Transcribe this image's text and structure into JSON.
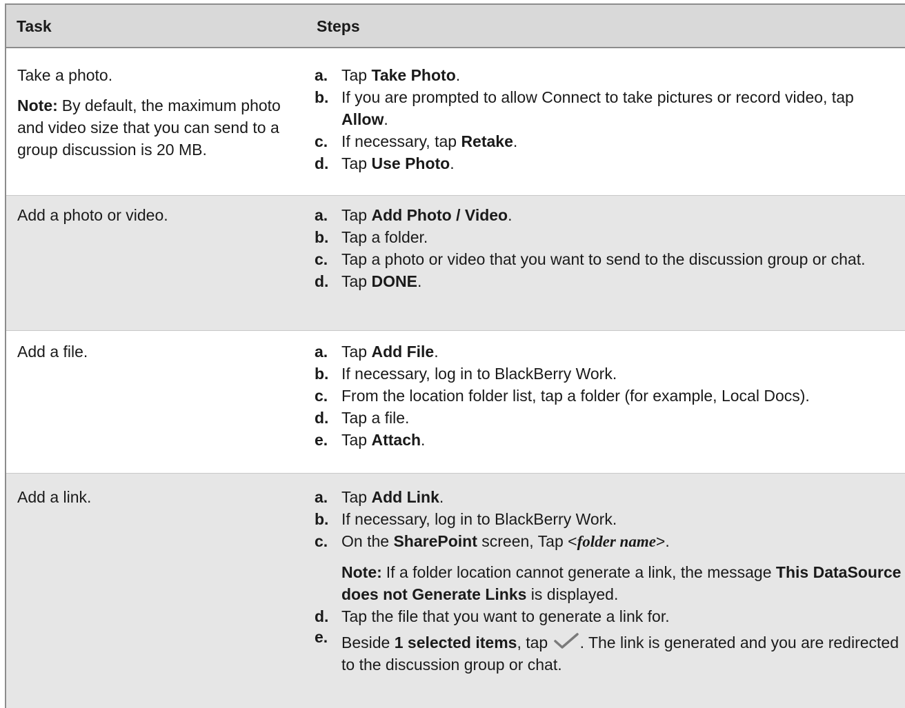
{
  "header": {
    "task": "Task",
    "steps": "Steps"
  },
  "rows": [
    {
      "task": "Take a photo.",
      "note_label": "Note:",
      "note_text": "By default, the maximum photo and video size that you can send to a group discussion is 20 MB.",
      "steps": [
        {
          "letter": "a.",
          "pre": "Tap ",
          "bold": "Take Photo",
          "post": "."
        },
        {
          "letter": "b.",
          "pre": "If you are prompted to allow Connect to take pictures or record video, tap ",
          "bold": "Allow",
          "post": "."
        },
        {
          "letter": "c.",
          "pre": "If necessary, tap ",
          "bold": "Retake",
          "post": "."
        },
        {
          "letter": "d.",
          "pre": "Tap ",
          "bold": "Use Photo",
          "post": "."
        }
      ]
    },
    {
      "task": "Add a photo or video.",
      "steps": [
        {
          "letter": "a.",
          "pre": "Tap ",
          "bold": "Add Photo / Video",
          "post": "."
        },
        {
          "letter": "b.",
          "pre": "Tap a folder.",
          "bold": "",
          "post": ""
        },
        {
          "letter": "c.",
          "pre": "Tap a photo or video that you want to send to the discussion group or chat.",
          "bold": "",
          "post": ""
        },
        {
          "letter": "d.",
          "pre": "Tap ",
          "bold": "DONE",
          "post": "."
        }
      ]
    },
    {
      "task": "Add a file.",
      "steps": [
        {
          "letter": "a.",
          "pre": "Tap ",
          "bold": "Add File",
          "post": "."
        },
        {
          "letter": "b.",
          "pre": "If necessary, log in to BlackBerry Work.",
          "bold": "",
          "post": ""
        },
        {
          "letter": "c.",
          "pre": "From the location folder list, tap a folder (for example, Local Docs).",
          "bold": "",
          "post": ""
        },
        {
          "letter": "d.",
          "pre": "Tap a file.",
          "bold": "",
          "post": ""
        },
        {
          "letter": "e.",
          "pre": "Tap ",
          "bold": "Attach",
          "post": "."
        }
      ]
    },
    {
      "task": "Add a link.",
      "steps": {
        "a": {
          "letter": "a.",
          "pre": "Tap ",
          "bold": "Add Link",
          "post": "."
        },
        "b": {
          "letter": "b.",
          "pre": "If necessary, log in to BlackBerry Work."
        },
        "c": {
          "letter": "c.",
          "pre": "On the ",
          "bold": "SharePoint",
          "mid": " screen, Tap <",
          "folder": "folder name",
          "post": ">.",
          "note_label": "Note:",
          "note_pre": "If a folder location cannot generate a link, the message ",
          "note_bold": "This DataSource does not Generate Links",
          "note_post": " is displayed."
        },
        "d": {
          "letter": "d.",
          "pre": "Tap the file that you want to generate a link for."
        },
        "e": {
          "letter": "e.",
          "pre": "Beside ",
          "bold": "1 selected items",
          "mid": ", tap ",
          "icon": "checkmark-icon",
          "post": ". The link is generated and you are redirected to the discussion group or chat."
        }
      }
    }
  ],
  "colors": {
    "header_bg": "#d9d9d9",
    "shaded_bg": "#e6e6e6",
    "checkmark": "#7a7a7a"
  }
}
